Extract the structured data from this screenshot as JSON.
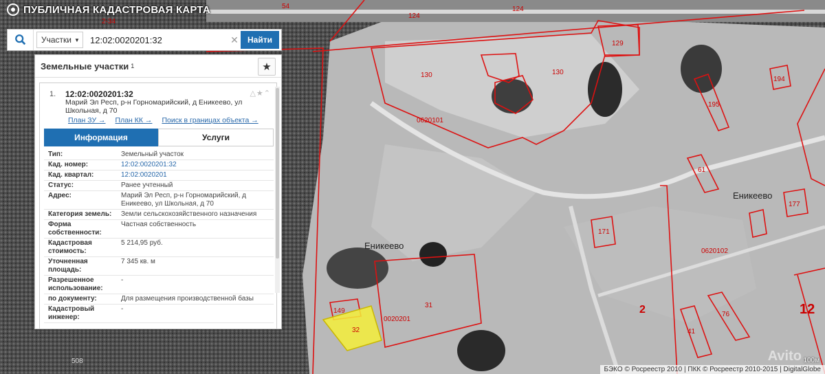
{
  "app": {
    "title": "ПУБЛИЧНАЯ КАДАСТРОВАЯ КАРТА"
  },
  "search": {
    "type": "Участки",
    "value": "12:02:0020201:32",
    "button": "Найти"
  },
  "panel": {
    "title": "Земельные участки",
    "title_sup": "1",
    "result": {
      "num": "1.",
      "cad": "12:02:0020201:32",
      "address": "Марий Эл Респ, р-н Горномарийский, д Еникеево, ул Школьная, д 70",
      "links": [
        "План ЗУ →",
        "План КК →",
        "Поиск в границах объекта →"
      ],
      "tabs": [
        "Информация",
        "Услуги"
      ]
    },
    "info": [
      {
        "k": "Тип:",
        "v": "Земельный участок"
      },
      {
        "k": "Кад. номер:",
        "v": "12:02:0020201:32"
      },
      {
        "k": "Кад. квартал:",
        "v": "12:02:0020201"
      },
      {
        "k": "Статус:",
        "v": "Ранее учтенный"
      },
      {
        "k": "Адрес:",
        "v": "Марий Эл Респ, р-н Горномарийский, д Еникеево, ул Школьная, д 70"
      },
      {
        "k": "Категория земель:",
        "v": "Земли сельскохозяйственного назначения"
      },
      {
        "k": "Форма собственности:",
        "v": "Частная собственность"
      },
      {
        "k": "Кадастровая стоимость:",
        "v": "5 214,95 руб."
      },
      {
        "k": "Уточненная площадь:",
        "v": "7 345 кв. м"
      },
      {
        "k": "Разрешенное использование:",
        "v": "-"
      },
      {
        "k": "по документу:",
        "v": "Для размещения производственной базы"
      },
      {
        "k": "Кадастровый инженер:",
        "v": "-"
      }
    ]
  },
  "map": {
    "labels": {
      "road_54": "54",
      "road_124a": "124",
      "road_124b": "124",
      "road_234": "2-34",
      "p130a": "130",
      "p130b": "130",
      "p129": "129",
      "p0620101": "0620101",
      "p61": "61",
      "p171": "171",
      "p177": "177",
      "p0620102": "0620102",
      "p149": "149",
      "p31": "31",
      "p0020201": "0020201",
      "p32": "32",
      "p2": "2",
      "p12": "12",
      "p41": "41",
      "p76": "76",
      "p508": "508",
      "p194": "194",
      "p195": "195",
      "village1": "Еникеево",
      "village2": "Еникеево"
    },
    "footer": "БЭКО © Росреестр 2010 | ПКК © Росреестр 2010-2015 | DigitalGlobe",
    "scale": "100м",
    "watermark": "Avito"
  }
}
